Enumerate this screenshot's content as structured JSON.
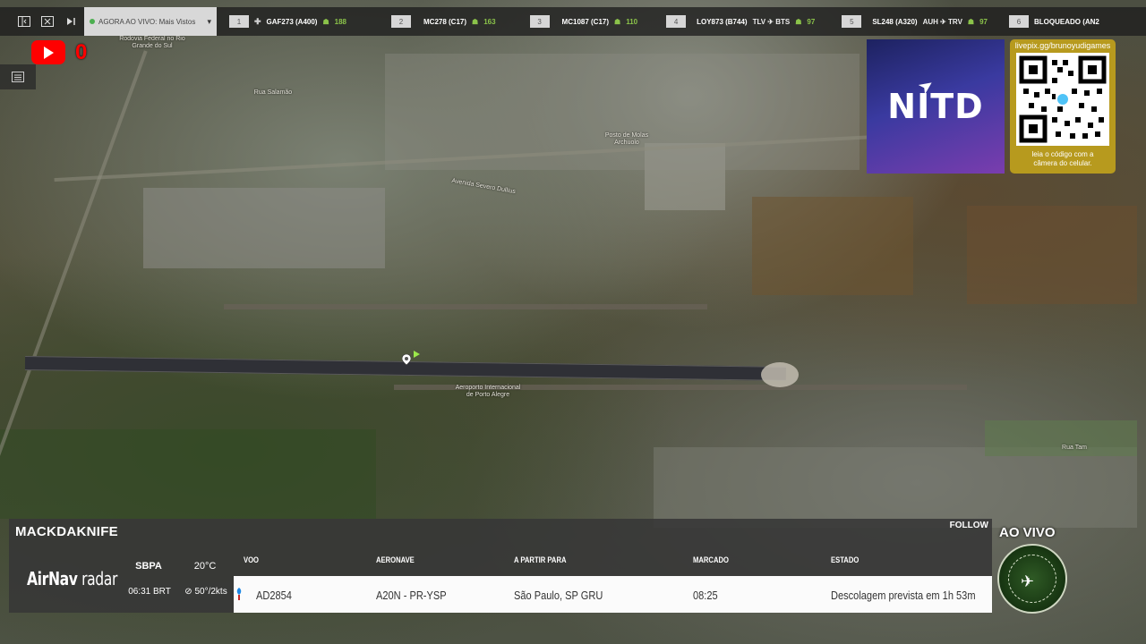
{
  "topbar": {
    "select_label": "AGORA AO VIVO: Mais Vistos",
    "flights": [
      {
        "num": "1",
        "code": "GAF273 (A400)",
        "route": "",
        "count": "188"
      },
      {
        "num": "2",
        "code": "MC278 (C17)",
        "route": "",
        "count": "163"
      },
      {
        "num": "3",
        "code": "MC1087 (C17)",
        "route": "",
        "count": "110"
      },
      {
        "num": "4",
        "code": "LOY873 (B744)",
        "route": "TLV ✈ BTS",
        "count": "97"
      },
      {
        "num": "5",
        "code": "SL248 (A320)",
        "route": "AUH ✈ TRV",
        "count": "97"
      },
      {
        "num": "6",
        "code": "BLOQUEADO (AN2",
        "route": "",
        "count": ""
      }
    ]
  },
  "youtube": {
    "count": "0"
  },
  "promo": {
    "logo_text": "NITD",
    "qr_url": "livepix.gg/brunoyudigames",
    "qr_caption_line1": "leia o código com a",
    "qr_caption_line2": "câmera do celular."
  },
  "map_labels": {
    "rodovia": "Rodovia Federal no Rio Grande do Sul",
    "airport_name": "Aeroporto Internacional de Porto Alegre",
    "posto": "Posto de Molas Archuolo",
    "rua_salamao": "Rua Salamão",
    "avenida_severo_dullius": "Avenida Severo Dullius",
    "rua_tam": "Rua Tam"
  },
  "panel": {
    "channel": "MACKDAKNIFE",
    "follow": "FOLLOW",
    "airnav_brand": "AirNav",
    "airnav_suffix": "radar",
    "airport_code": "SBPA",
    "local_time": "06:31 BRT",
    "temperature": "20°C",
    "wind": "50°/2kts",
    "headers": {
      "voo": "VOO",
      "aeronave": "AERONAVE",
      "destino": "A PARTIR PARA",
      "marcado": "MARCADO",
      "estado": "ESTADO"
    },
    "row": {
      "voo": "AD2854",
      "aeronave": "A20N - PR-YSP",
      "destino": "São Paulo, SP GRU",
      "marcado": "08:25",
      "estado": "Descolagem prevista em 1h 53m"
    }
  },
  "live": {
    "label": "AO VIVO"
  }
}
